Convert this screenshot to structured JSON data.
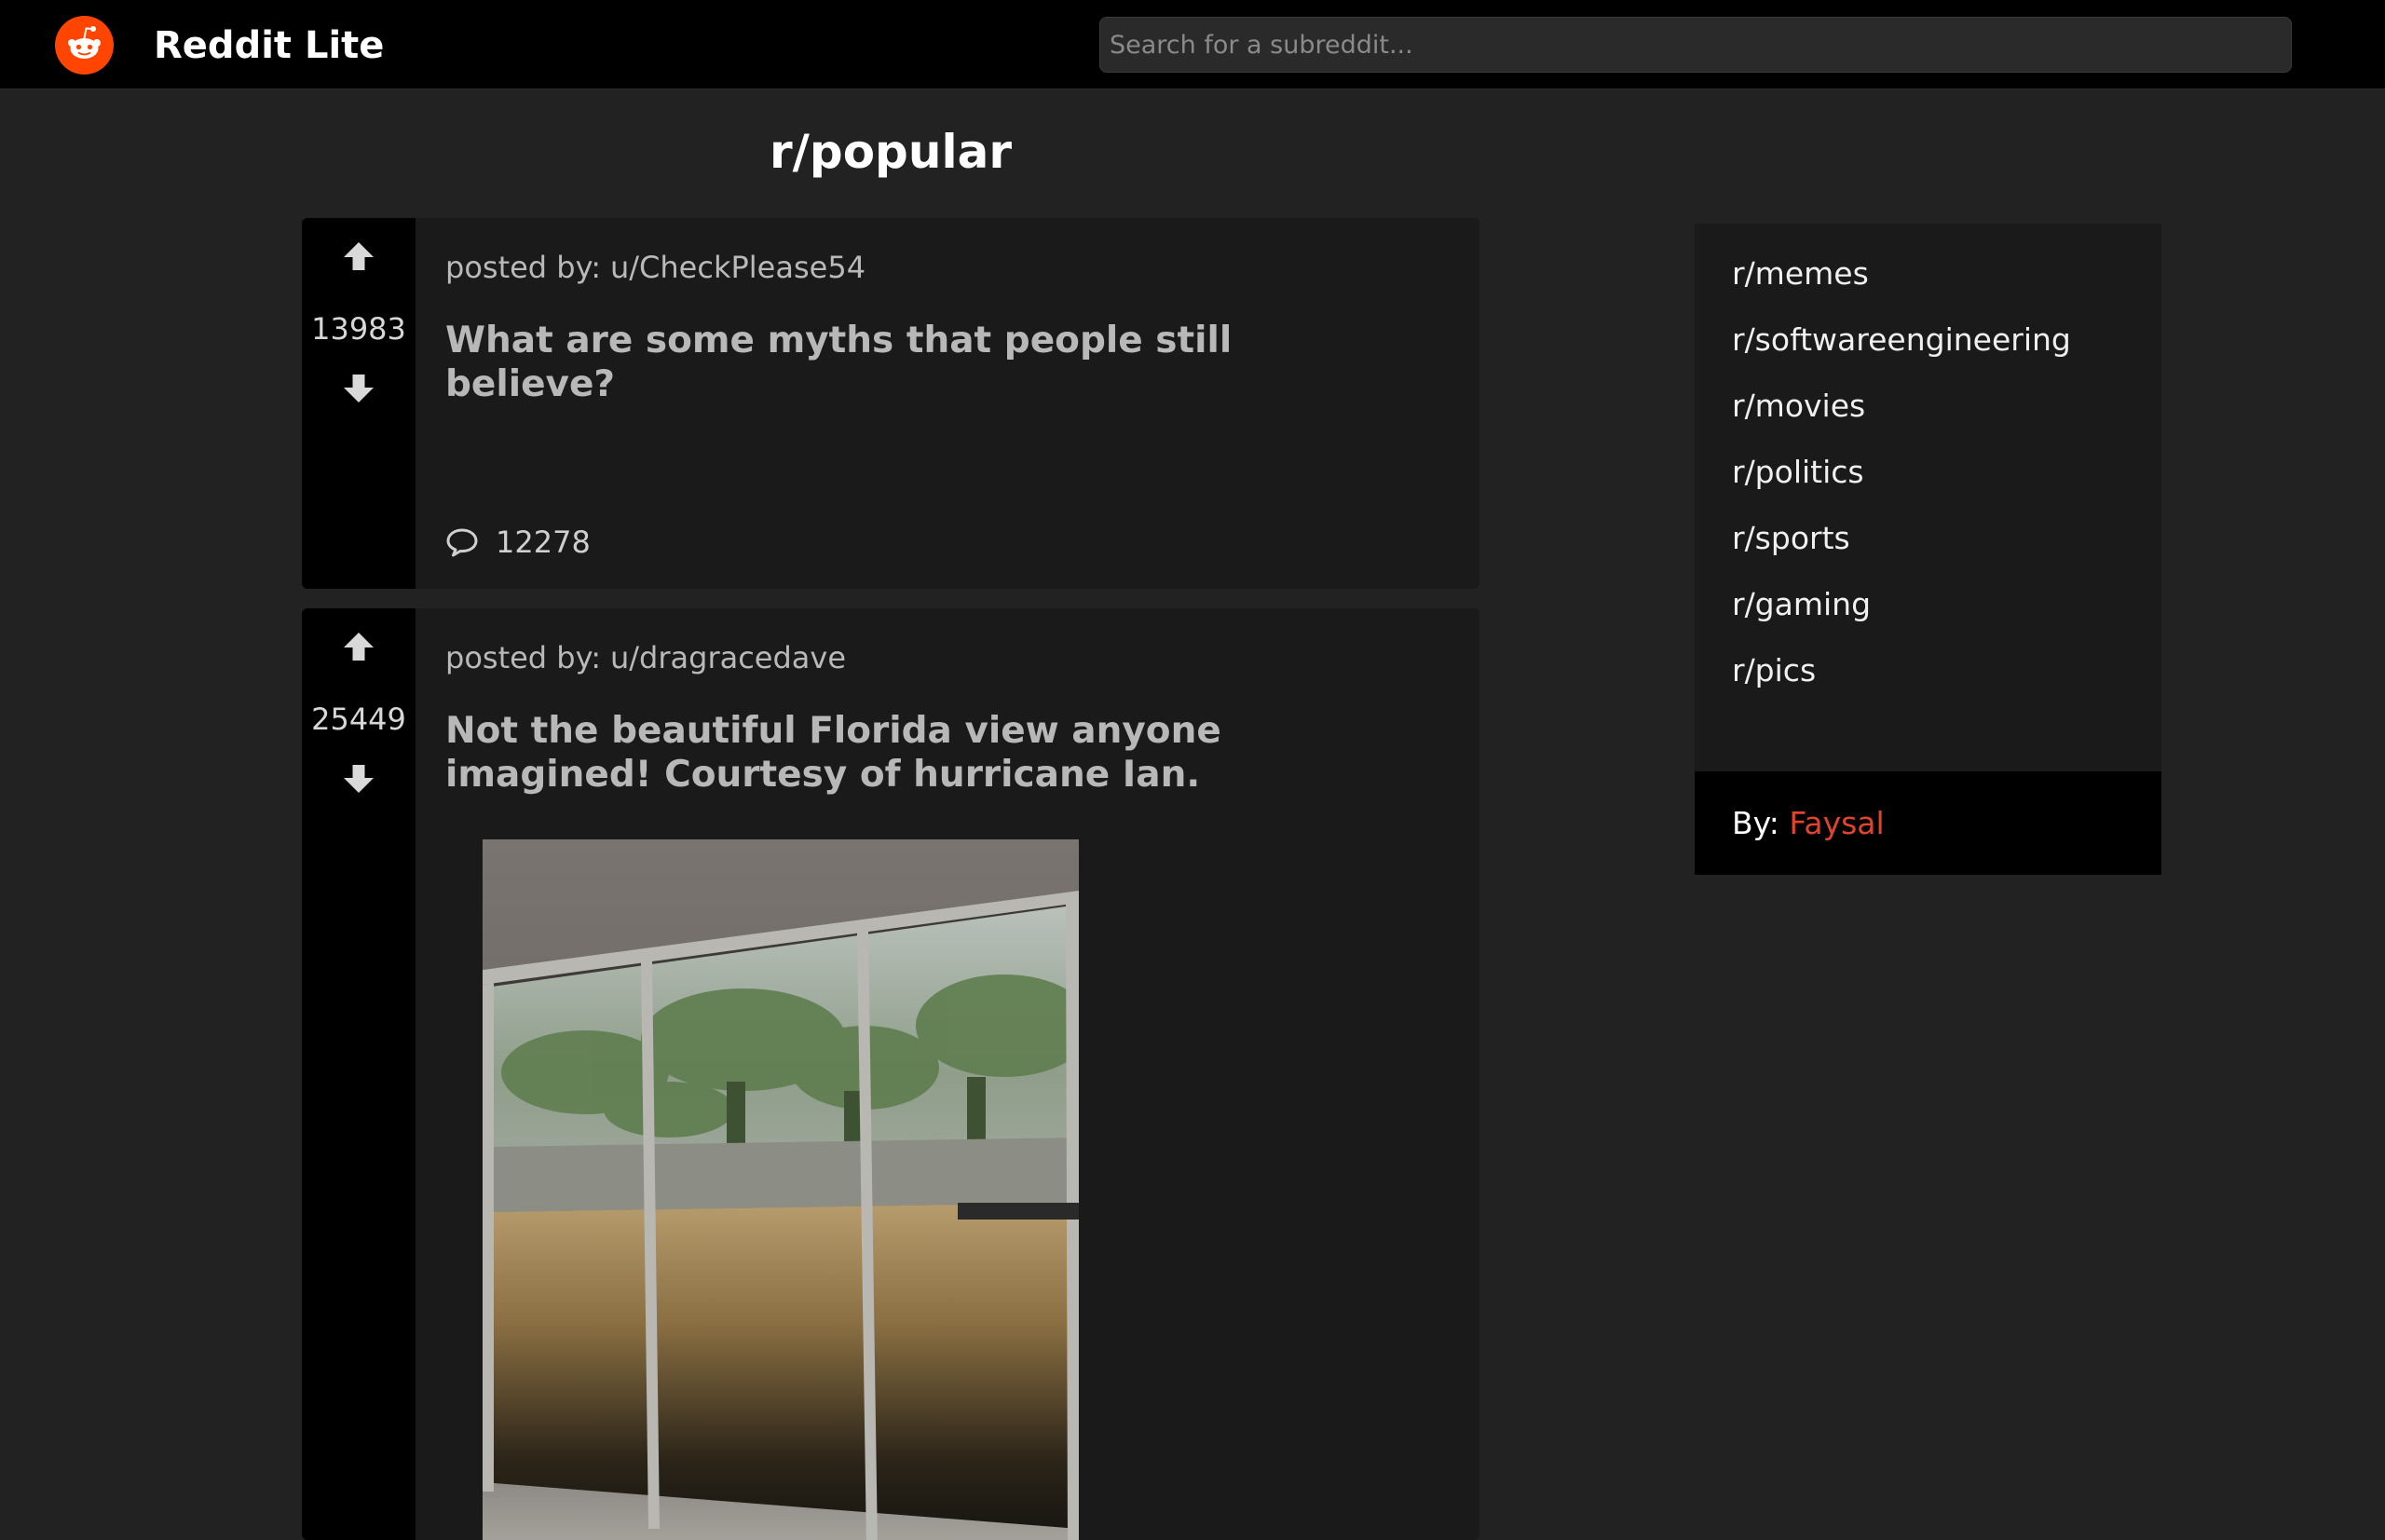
{
  "header": {
    "app_title": "Reddit Lite",
    "logo_icon": "reddit-logo-icon",
    "brand_color": "#ff4500",
    "search_placeholder": "Search for a subreddit..."
  },
  "feed": {
    "title": "r/popular"
  },
  "posts": [
    {
      "posted_by_label": "posted by:",
      "author": "u/CheckPlease54",
      "score": "13983",
      "title": "What are some myths that people still believe?",
      "comment_count": "12278",
      "has_image": false
    },
    {
      "posted_by_label": "posted by:",
      "author": "u/dragracedave",
      "score": "25449",
      "title": "Not the beautiful Florida view anyone imagined! Courtesy of hurricane Ian.",
      "has_image": true
    }
  ],
  "icons": {
    "upvote": "arrow-up-icon",
    "downvote": "arrow-down-icon",
    "comments": "speech-bubble-icon"
  },
  "sidebar": {
    "subreddits": [
      "r/memes",
      "r/softwareengineering",
      "r/movies",
      "r/politics",
      "r/sports",
      "r/gaming",
      "r/pics"
    ],
    "by_label": "By:",
    "author": "Faysal",
    "author_color": "#e0452b"
  }
}
